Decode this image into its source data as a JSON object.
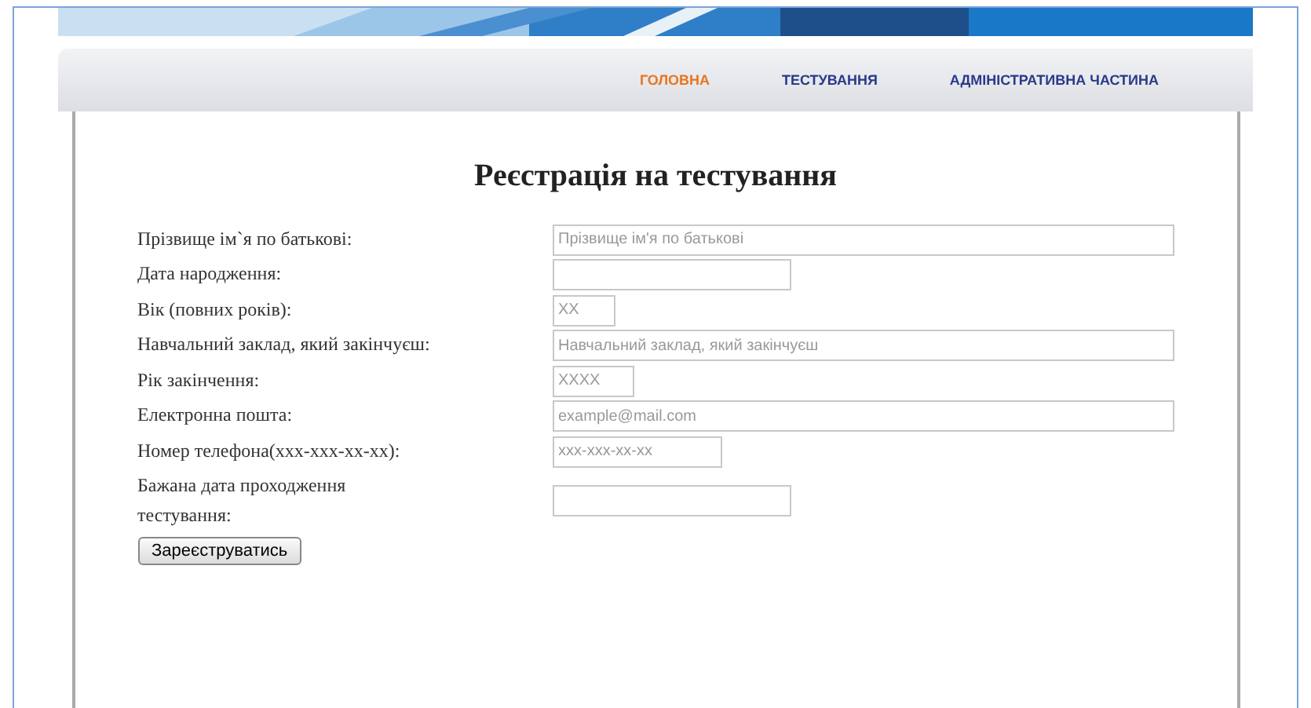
{
  "nav": [
    {
      "label": "ГОЛОВНА",
      "selected": true
    },
    {
      "label": "ТЕСТУВАННЯ",
      "selected": false
    },
    {
      "label": "АДМІНІСТРАТИВНА ЧАСТИНА",
      "selected": false
    }
  ],
  "form": {
    "title": "Реєстрація на тестування",
    "fields": [
      {
        "label": "Прізвище ім`я по батькові:",
        "placeholder": "Прізвище ім'я по батькові"
      },
      {
        "label": "Дата народження:"
      },
      {
        "label": "Вік (повних років):",
        "placeholder": "XX"
      },
      {
        "label": "Навчальний заклад, який закінчуєш:",
        "placeholder": "Навчальний заклад, який закінчуєш"
      },
      {
        "label": "Рік закінчення:",
        "placeholder": "XXXX"
      },
      {
        "label": "Електронна пошта:",
        "placeholder": "example@mail.com"
      },
      {
        "label": "Номер телефона(xxx-xxx-xx-xx):",
        "placeholder": "xxx-xxx-xx-xx"
      },
      {
        "label": "Бажана дата проходження тестування:"
      }
    ],
    "submit": "Зареєструватись"
  }
}
